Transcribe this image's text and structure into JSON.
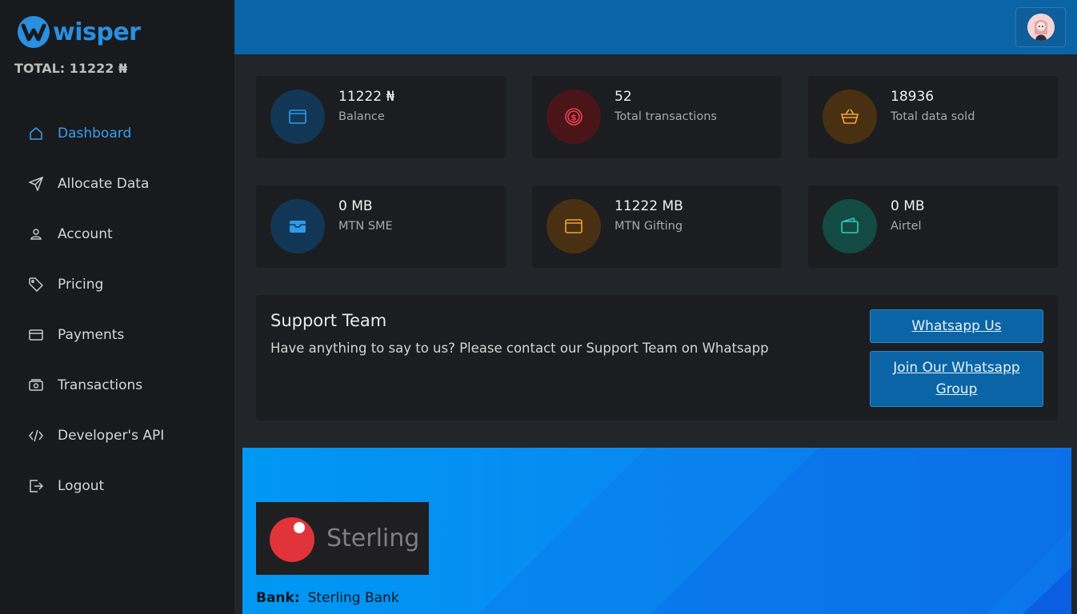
{
  "app": {
    "brand": "wisper",
    "total_text": "TOTAL: 11222 ₦"
  },
  "nav": [
    {
      "label": "Dashboard",
      "icon": "home-icon",
      "active": true
    },
    {
      "label": "Allocate Data",
      "icon": "send-icon"
    },
    {
      "label": "Account",
      "icon": "user-icon"
    },
    {
      "label": "Pricing",
      "icon": "tag-icon"
    },
    {
      "label": "Payments",
      "icon": "credit-card-icon"
    },
    {
      "label": "Transactions",
      "icon": "cash-icon"
    },
    {
      "label": "Developer's API",
      "icon": "code-icon"
    },
    {
      "label": "Logout",
      "icon": "logout-icon"
    }
  ],
  "stats": [
    {
      "value": "11222 ₦",
      "caption": "Balance",
      "icon": "wallet-icon",
      "color": "#2f9be8"
    },
    {
      "value": "52",
      "caption": "Total transactions",
      "icon": "dollar-coin-icon",
      "color": "#e8424e"
    },
    {
      "value": "18936",
      "caption": "Total data sold",
      "icon": "basket-icon",
      "color": "#f2a43a"
    },
    {
      "value": "0 MB",
      "caption": "MTN SME",
      "icon": "inbox-icon",
      "color": "#2f9be8"
    },
    {
      "value": "11222 MB",
      "caption": "MTN Gifting",
      "icon": "wallet-icon",
      "color": "#f2a43a"
    },
    {
      "value": "0 MB",
      "caption": "Airtel",
      "icon": "wallet2-icon",
      "color": "#2fd0b8"
    }
  ],
  "support": {
    "title": "Support Team",
    "text": "Have anything to say to us? Please contact our Support Team on Whatsapp",
    "btn_whatsapp": "Whatsapp Us",
    "btn_group": "Join Our Whatsapp Group"
  },
  "bank": {
    "logo_text": "Sterling",
    "label": "Bank:",
    "value": "Sterling Bank"
  },
  "colors": {
    "accent": "#3aa0f0",
    "topbar": "#0a64a5",
    "sidebar": "#181a1d",
    "content_bg": "#22262a"
  }
}
